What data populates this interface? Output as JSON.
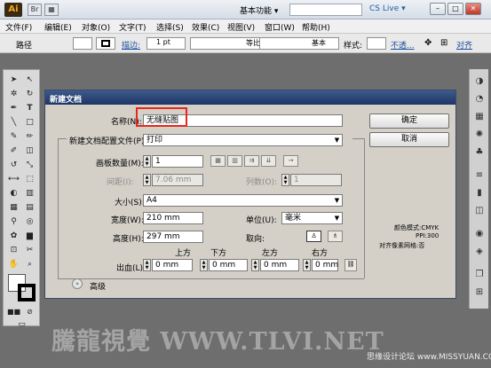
{
  "titlebar": {
    "app_logo": "Ai",
    "workspace": "基本功能 ▾",
    "cslive": "CS Live ▾",
    "win_min": "–",
    "win_max": "□",
    "win_close": "✕"
  },
  "menu": [
    "文件(F)",
    "编辑(E)",
    "对象(O)",
    "文字(T)",
    "选择(S)",
    "效果(C)",
    "视图(V)",
    "窗口(W)",
    "帮助(H)"
  ],
  "control_bar": {
    "label": "路径",
    "stroke_link": "描边:",
    "stroke_value": "1 pt",
    "profile": "等比",
    "brush": "基本",
    "style": "样式:",
    "opacity": "不透...",
    "align": "对齐"
  },
  "dialog": {
    "title": "新建文档",
    "name_label": "名称(N):",
    "name_value": "无缝贴图",
    "profile_label": "新建文档配置文件(P):",
    "profile_value": "打印",
    "artboards_label": "画板数量(M):",
    "artboards_value": "1",
    "spacing_label": "间距(I):",
    "spacing_value": "7.06 mm",
    "columns_label": "列数(O):",
    "columns_value": "1",
    "size_label": "大小(S):",
    "size_value": "A4",
    "width_label": "宽度(W):",
    "width_value": "210 mm",
    "units_label": "单位(U):",
    "units_value": "毫米",
    "height_label": "高度(H):",
    "height_value": "297 mm",
    "orientation_label": "取向:",
    "bleed_label": "出血(L):",
    "bleed": [
      {
        "label": "上方",
        "value": "0 mm"
      },
      {
        "label": "下方",
        "value": "0 mm"
      },
      {
        "label": "左方",
        "value": "0 mm"
      },
      {
        "label": "右方",
        "value": "0 mm"
      }
    ],
    "advanced": "高级",
    "ok": "确定",
    "cancel": "取消",
    "info": {
      "color_mode": "颜色模式:CMYK",
      "ppi": "PPI:300",
      "align_grid": "对齐像素网格:否"
    }
  },
  "watermark": "騰龍視覺 WWW.TLVI.NET",
  "credit": "思缘设计论坛 www.MISSYUAN.COM"
}
